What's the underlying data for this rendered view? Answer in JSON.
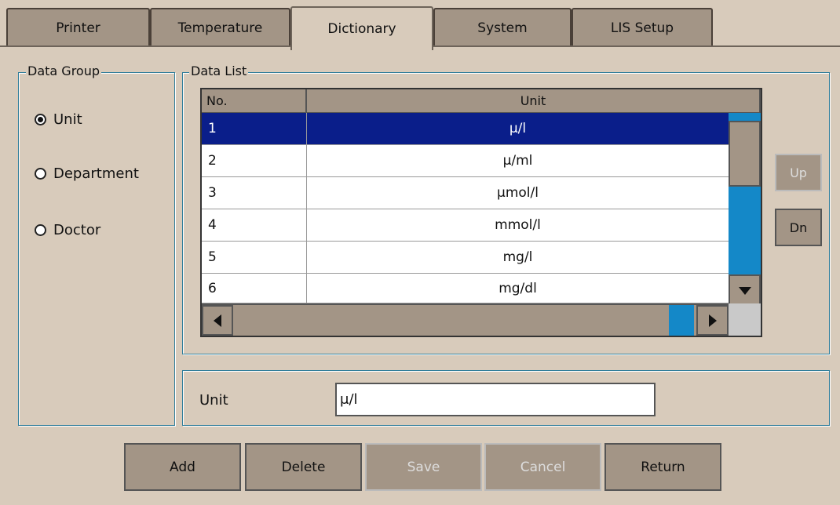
{
  "tabs": [
    "Printer",
    "Temperature",
    "Dictionary",
    "System",
    "LIS Setup"
  ],
  "active_tab": "Dictionary",
  "data_group": {
    "title": "Data Group",
    "options": [
      "Unit",
      "Department",
      "Doctor"
    ],
    "selected": "Unit"
  },
  "data_list": {
    "title": "Data List",
    "columns": [
      "No.",
      "Unit"
    ],
    "rows": [
      {
        "no": "1",
        "unit": "μ/l"
      },
      {
        "no": "2",
        "unit": "μ/ml"
      },
      {
        "no": "3",
        "unit": "μmol/l"
      },
      {
        "no": "4",
        "unit": "mmol/l"
      },
      {
        "no": "5",
        "unit": "mg/l"
      },
      {
        "no": "6",
        "unit": "mg/dl"
      }
    ],
    "selected_row": "1"
  },
  "side_buttons": {
    "up": "Up",
    "dn": "Dn"
  },
  "editor": {
    "label": "Unit",
    "value": "μ/l"
  },
  "buttons": {
    "add": "Add",
    "delete": "Delete",
    "save": "Save",
    "cancel": "Cancel",
    "return": "Return"
  },
  "colors": {
    "background": "#d8cbbb",
    "button": "#a39586",
    "selection": "#0a1e8a",
    "scroll_track": "#1488c8",
    "group_border": "#2e7d9a"
  }
}
